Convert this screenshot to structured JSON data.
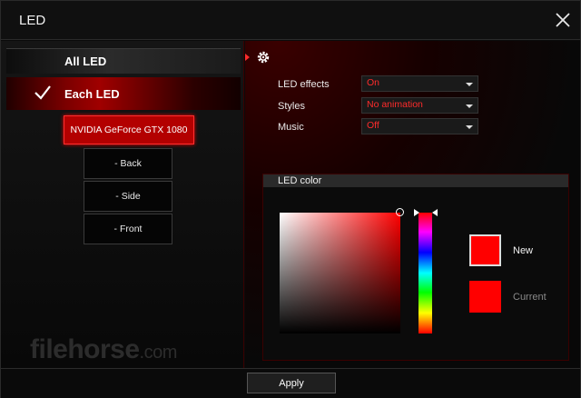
{
  "window": {
    "title": "LED"
  },
  "nav": {
    "all_led": "All LED",
    "each_led": "Each LED"
  },
  "devices": {
    "gpu": "NVIDIA GeForce GTX 1080",
    "zones": [
      "- Back",
      "- Side",
      "- Front"
    ]
  },
  "settings": {
    "led_effects": {
      "label": "LED effects",
      "value": "On"
    },
    "styles": {
      "label": "Styles",
      "value": "No animation"
    },
    "music": {
      "label": "Music",
      "value": "Off"
    }
  },
  "led_color": {
    "title": "LED color",
    "new_label": "New",
    "current_label": "Current",
    "new_color": "#ff0000",
    "current_color": "#ff0000"
  },
  "footer": {
    "apply": "Apply"
  },
  "watermark": {
    "main": "filehorse",
    "suffix": ".com"
  },
  "colors": {
    "accent": "#ff2b2b",
    "active": "#b30000"
  }
}
